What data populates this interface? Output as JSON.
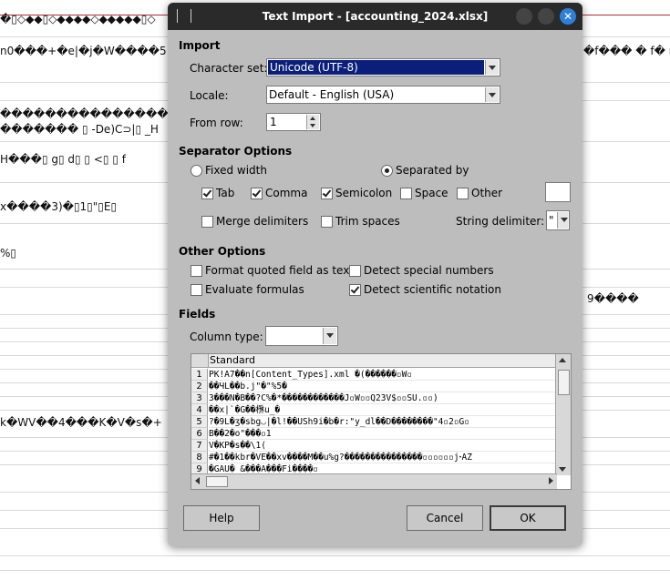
{
  "background": {
    "fragments": [
      {
        "id": "f0",
        "text": "�▯◇◆◆▯◇◆◆◆◆◇◆◆◆◆◆▯◇"
      },
      {
        "id": "f1",
        "text": "n0���+�e|�j�W����5"
      },
      {
        "id": "f1r",
        "text": "�f��� � f� ny"
      },
      {
        "id": "f2",
        "text": "�������������������"
      },
      {
        "id": "f3",
        "text": "������� ▯ -De)C⊃|▯ _H"
      },
      {
        "id": "f4",
        "text": "H���▯ g▯ d▯ ▯ <▯ ▯ f"
      },
      {
        "id": "f5",
        "text": "x����3)�▯1▯\"▯E▯"
      },
      {
        "id": "f6",
        "text": "%▯"
      },
      {
        "id": "f7",
        "text": "9����"
      },
      {
        "id": "f8",
        "text": "k�WV��4���K�V�s�+"
      }
    ]
  },
  "dialog": {
    "title": "Text Import - [accounting_2024.xlsx]",
    "close_glyph": "✕",
    "import_section": "Import",
    "charset_label": "Character set:",
    "charset_value": "Unicode (UTF-8)",
    "locale_label": "Locale:",
    "locale_value": "Default - English (USA)",
    "fromrow_label": "From row:",
    "fromrow_value": "1",
    "separator_section": "Separator Options",
    "fixed_width": "Fixed width",
    "separated_by": "Separated by",
    "tab": "Tab",
    "comma": "Comma",
    "semicolon": "Semicolon",
    "space": "Space",
    "other": "Other",
    "merge_delimiters": "Merge delimiters",
    "trim_spaces": "Trim spaces",
    "string_delimiter_label": "String delimiter:",
    "string_delimiter_value": "\"",
    "other_section": "Other Options",
    "format_quoted": "Format quoted field as text",
    "detect_special": "Detect special numbers",
    "evaluate_formulas": "Evaluate formulas",
    "detect_scientific": "Detect scientific notation",
    "fields_section": "Fields",
    "column_type_label": "Column type:",
    "column_type_value": "",
    "preview_header": "Standard",
    "preview_rows": [
      {
        "num": "1",
        "text": "PK!A7��n[Content_Types].xml �(������▫W▫"
      },
      {
        "num": "2",
        "text": "��ЧL��b.j\"�\"%5�"
      },
      {
        "num": "3",
        "text": "3���N�B��?C%�*������������J▫W▫▫Q23V$▫▫SU.▫▫)"
      },
      {
        "num": "4",
        "text": "��x|`�G��㮊u_�"
      },
      {
        "num": "5",
        "text": "?�9L�ʒ�sbg◡|�l!��USh9i�b�r:\"y_dl��D��������\"4▫2▫G▫"
      },
      {
        "num": "6",
        "text": "B��2�o\"���▫1"
      },
      {
        "num": "7",
        "text": "V�KP�s��\\1("
      },
      {
        "num": "8",
        "text": "#�1��kbr�VE��xv����M��u%g?���������������▫▫▫▫▫▫jꞏAZ"
      },
      {
        "num": "9",
        "text": "�GAU�_&���A���Fi����▫"
      }
    ],
    "help": "Help",
    "cancel": "Cancel",
    "ok": "OK"
  }
}
